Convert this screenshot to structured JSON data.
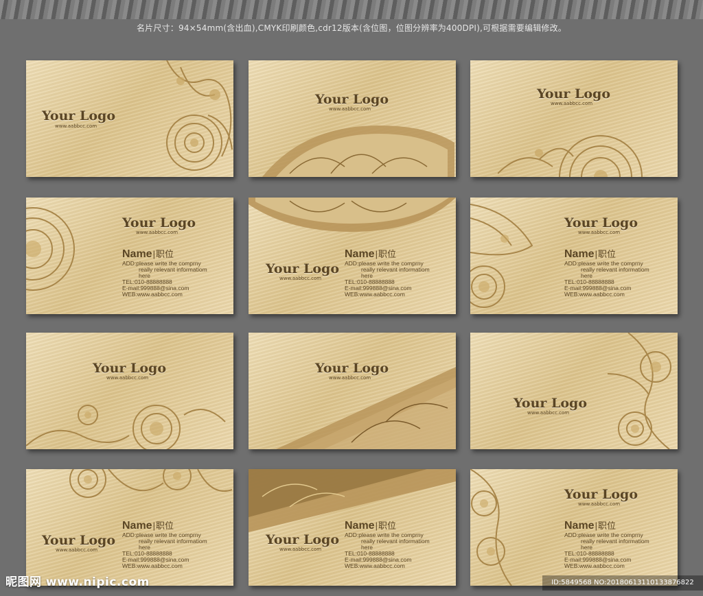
{
  "spec_text": "名片尺寸：94×54mm(含出血),CMYK印刷颜色,cdr12版本(含位图，位图分辨率为400DPI),可根据需要编辑修改。",
  "logo_text": "Your Logo",
  "url_text": "www.aabbcc.com",
  "name_text": "Name",
  "title_text": "职位",
  "separator": "|",
  "add_line1": "ADD:please write the comprny",
  "add_line2": "really relevant informatiom",
  "add_line3": "here",
  "tel_text": "TEL:010-88888888",
  "email_text": "E-mail:999888@sina.com",
  "web_text": "WEB:www.aabbcc.com",
  "watermark_left": "昵图网 www.nipic.com",
  "watermark_right": "ID:5849568 NO:20180613110133876822",
  "colors": {
    "background": "#6f6f6f",
    "card_gold": "#e4cf9f",
    "ink": "#5a4524"
  },
  "icons": [
    "floral-ornament",
    "swoosh-band",
    "diagonal-band"
  ]
}
